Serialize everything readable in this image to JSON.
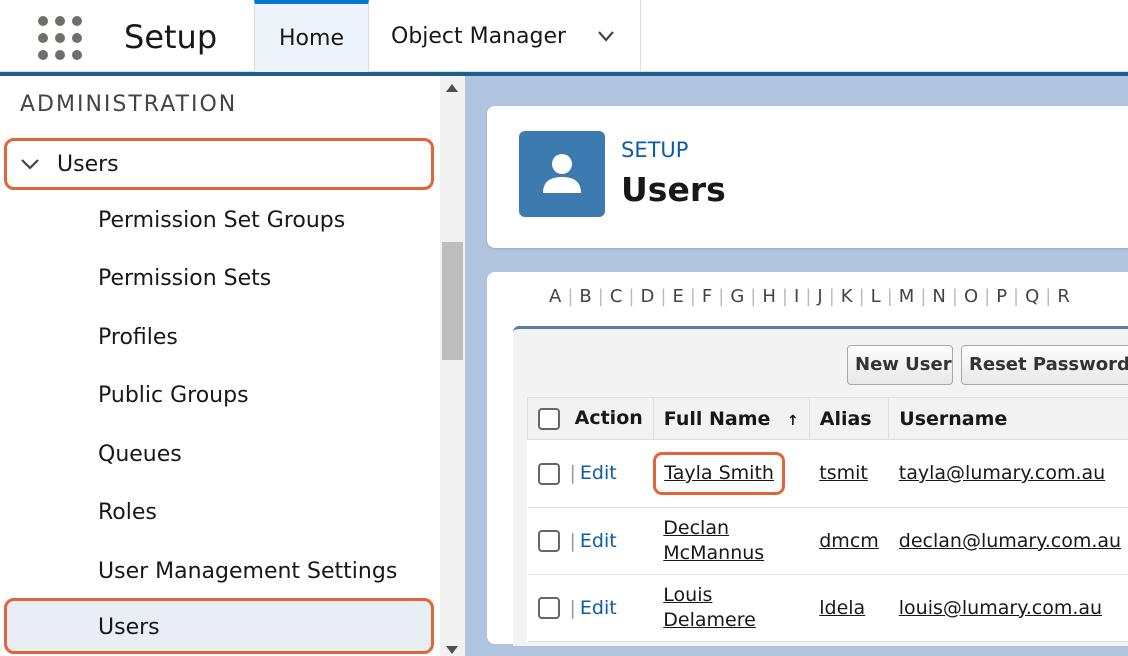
{
  "header": {
    "app_title": "Setup",
    "tabs": [
      {
        "label": "Home",
        "active": true
      },
      {
        "label": "Object Manager",
        "active": false
      }
    ]
  },
  "sidebar": {
    "heading": "ADMINISTRATION",
    "parent": {
      "label": "Users",
      "expanded": true
    },
    "items": [
      {
        "label": "Permission Set Groups"
      },
      {
        "label": "Permission Sets"
      },
      {
        "label": "Profiles"
      },
      {
        "label": "Public Groups"
      },
      {
        "label": "Queues"
      },
      {
        "label": "Roles"
      },
      {
        "label": "User Management Settings"
      },
      {
        "label": "Users",
        "active": true
      }
    ]
  },
  "page_header": {
    "eyebrow": "SETUP",
    "title": "Users",
    "icon": "user-icon"
  },
  "alphabet": [
    "A",
    "B",
    "C",
    "D",
    "E",
    "F",
    "G",
    "H",
    "I",
    "J",
    "K",
    "L",
    "M",
    "N",
    "O",
    "P",
    "Q",
    "R"
  ],
  "toolbar": {
    "new_user_label": "New User",
    "reset_password_label": "Reset Password(s)"
  },
  "table": {
    "columns": {
      "action": "Action",
      "full_name": "Full Name",
      "sort_indicator": "↑",
      "alias": "Alias",
      "username": "Username"
    },
    "edit_label": "Edit",
    "pipe": "|",
    "rows": [
      {
        "full_name": "Tayla Smith",
        "name_line1": "Tayla Smith",
        "name_line2": "",
        "alias": "tsmit",
        "username": "tayla@lumary.com.au"
      },
      {
        "full_name": "Declan McMannus",
        "name_line1": "Declan",
        "name_line2": "McMannus",
        "alias": "dmcm",
        "username": "declan@lumary.com.au"
      },
      {
        "full_name": "Louis Delamere",
        "name_line1": "Louis",
        "name_line2": "Delamere",
        "alias": "ldela",
        "username": "louis@lumary.com.au"
      }
    ]
  },
  "colors": {
    "highlight": "#e2643a",
    "brand_blue": "#1b5f8e",
    "link_blue": "#0b5cab",
    "background": "#b0c4df"
  }
}
